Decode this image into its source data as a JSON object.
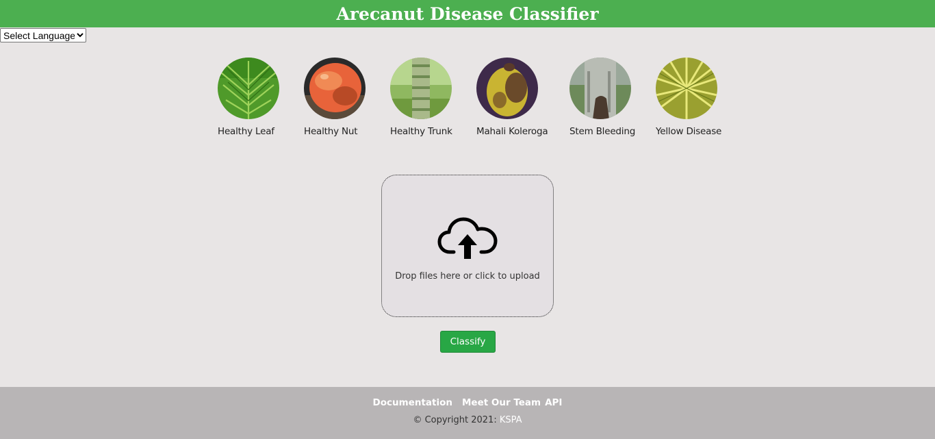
{
  "header": {
    "title": "Arecanut Disease Classifier"
  },
  "language": {
    "selected": "Select Language"
  },
  "categories": [
    {
      "label": "Healthy Leaf",
      "icon": "healthy-leaf-image"
    },
    {
      "label": "Healthy Nut",
      "icon": "healthy-nut-image"
    },
    {
      "label": "Healthy Trunk",
      "icon": "healthy-trunk-image"
    },
    {
      "label": "Mahali Koleroga",
      "icon": "mahali-koleroga-image"
    },
    {
      "label": "Stem Bleeding",
      "icon": "stem-bleeding-image"
    },
    {
      "label": "Yellow Disease",
      "icon": "yellow-disease-image"
    }
  ],
  "upload": {
    "icon": "cloud-upload-icon",
    "text": "Drop files here or click to upload"
  },
  "classify": {
    "label": "Classify"
  },
  "footer": {
    "links": [
      "Documentation",
      "Meet Our Team",
      "API"
    ],
    "copyright_prefix": "© Copyright 2021: ",
    "copyright_link": "KSPA"
  },
  "colors": {
    "header": "#4caf50",
    "button": "#28a745",
    "footer": "#b8b5b6",
    "background": "#e8e5e5"
  }
}
